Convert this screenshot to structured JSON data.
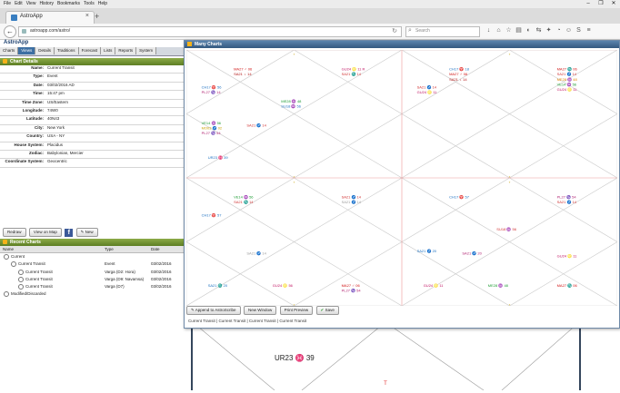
{
  "browser": {
    "menu": [
      "File",
      "Edit",
      "View",
      "History",
      "Bookmarks",
      "Tools",
      "Help"
    ],
    "tab_title": "AstroApp",
    "url": "astroapp.com/astro/",
    "search_placeholder": "Search",
    "window_controls": [
      "–",
      "❐",
      "✕"
    ]
  },
  "app": {
    "title": "AstroApp",
    "tabs": [
      "Charts",
      "Views",
      "Details",
      "Traditions",
      "Forecast",
      "Lists",
      "Reports",
      "System"
    ],
    "active_tab": "Views"
  },
  "chart_details": {
    "header": "Chart Details",
    "rows": [
      {
        "k": "Name:",
        "v": "Current Transit"
      },
      {
        "k": "Type:",
        "v": "Event"
      },
      {
        "k": "Date:",
        "v": "03/02/2016 AD"
      },
      {
        "k": "Time:",
        "v": "15:47 pm"
      },
      {
        "k": "Time Zone:",
        "v": "US/Eastern"
      },
      {
        "k": "Longitude:",
        "v": "74W0"
      },
      {
        "k": "Latitude:",
        "v": "40N43"
      },
      {
        "k": "City:",
        "v": "New York"
      },
      {
        "k": "Country:",
        "v": "USA - NY"
      },
      {
        "k": "House System:",
        "v": "Placidus"
      },
      {
        "k": "Zodiac:",
        "v": "Babylonian, Mercier"
      },
      {
        "k": "Coordinate System:",
        "v": "Geocentric"
      }
    ],
    "buttons": {
      "redraw": "Redraw",
      "view_on_map": "View on Map",
      "facebook": "f",
      "new": "New"
    }
  },
  "recent_charts": {
    "header": "Recent Charts",
    "columns": [
      "Name",
      "Type",
      "Date"
    ],
    "rows": [
      {
        "indent": 0,
        "name": "Current",
        "type": "",
        "date": ""
      },
      {
        "indent": 1,
        "name": "Current Transit",
        "type": "Event",
        "date": "03/02/2016"
      },
      {
        "indent": 2,
        "name": "Current Transit",
        "type": "Varga (D2: Hora)",
        "date": "03/02/2016"
      },
      {
        "indent": 2,
        "name": "Current Transit",
        "type": "Varga (D9: Navamsa)",
        "date": "03/02/2016"
      },
      {
        "indent": 2,
        "name": "Current Transit",
        "type": "Varga (D7)",
        "date": "03/02/2016"
      },
      {
        "indent": 0,
        "name": "Modified/Discarded",
        "type": "",
        "date": ""
      }
    ]
  },
  "many_charts": {
    "header": "Many Charts",
    "buttons": [
      "Append to AstroScribe",
      "New Window",
      "Print Preview",
      "Save"
    ],
    "footer_links": [
      "Current Transit",
      "Current Transit",
      "Current Transit",
      "Current Transit"
    ],
    "chart_labels": [
      {
        "cell": 0,
        "text": "MA27 ♂ 06",
        "color": "#d01010",
        "pos": "tl"
      },
      {
        "cell": 0,
        "text": "SA21 ♄ 14",
        "color": "#b01010",
        "pos": "tl2"
      },
      {
        "cell": 0,
        "text": "CH17 ♈ 56",
        "color": "#1a6fc0",
        "pos": "left"
      },
      {
        "cell": 0,
        "text": "PL27 ♑ 14",
        "color": "#b02070",
        "pos": "left2"
      },
      {
        "cell": 0,
        "text": "GU24 ♌ 11 R",
        "color": "#c01060",
        "pos": "right"
      },
      {
        "cell": 0,
        "text": "SA21 ♏ 14",
        "color": "#d03030",
        "pos": "right2"
      },
      {
        "cell": 0,
        "text": "ME28 ♒ 48",
        "color": "#1a9a30",
        "pos": "center"
      },
      {
        "cell": 0,
        "text": "SU18 ♒ 56",
        "color": "#1a6fc0",
        "pos": "center2"
      },
      {
        "cell": 0,
        "text": "SA21 ♐ 14",
        "color": "#d03030",
        "pos": "lower"
      },
      {
        "cell": 0,
        "text": "VE14 ♒ 56",
        "color": "#1a9a30",
        "pos": "lowerleft"
      },
      {
        "cell": 0,
        "text": "MO03 ♐ 02",
        "color": "#c8a000",
        "pos": "lowerleft2"
      },
      {
        "cell": 0,
        "text": "PL27 ♑ 54",
        "color": "#b02070",
        "pos": "lowerleft3"
      },
      {
        "cell": 0,
        "text": "UR23 ♓ 39",
        "color": "#1a6fc0",
        "pos": "bottom"
      },
      {
        "cell": 1,
        "text": "CH17 ♈ 18",
        "color": "#1a6fc0",
        "pos": "tl"
      },
      {
        "cell": 1,
        "text": "MA27 ♂ 06",
        "color": "#d01010",
        "pos": "tl2"
      },
      {
        "cell": 1,
        "text": "SA21 ♄ 14",
        "color": "#b01010",
        "pos": "tl3"
      },
      {
        "cell": 1,
        "text": "SA21 ♐ 14",
        "color": "#d03030",
        "pos": "left"
      },
      {
        "cell": 1,
        "text": "GU24 ♌ 11",
        "color": "#c01060",
        "pos": "left2"
      },
      {
        "cell": 1,
        "text": "MA27 ♏ 06",
        "color": "#d01010",
        "pos": "right"
      },
      {
        "cell": 1,
        "text": "SA21 ♐ 14",
        "color": "#d03030",
        "pos": "right2"
      },
      {
        "cell": 1,
        "text": "ME28 ♒ 48",
        "color": "#e08000",
        "pos": "right3"
      },
      {
        "cell": 1,
        "text": "VE14 ♒ 56",
        "color": "#1a9a30",
        "pos": "right4"
      },
      {
        "cell": 1,
        "text": "GU24 ♌ 11",
        "color": "#c01060",
        "pos": "right5"
      },
      {
        "cell": 2,
        "text": "CH17 ♈ 57",
        "color": "#1a6fc0",
        "pos": "left"
      },
      {
        "cell": 2,
        "text": "VE14 ♒ 56",
        "color": "#1a9a30",
        "pos": "tl"
      },
      {
        "cell": 2,
        "text": "SA21 ♏ 14",
        "color": "#d03030",
        "pos": "tl2"
      },
      {
        "cell": 2,
        "text": "SA21 ♐ 14",
        "color": "#d03030",
        "pos": "right"
      },
      {
        "cell": 2,
        "text": "SA21 ♐ 14",
        "color": "#999999",
        "pos": "lower"
      },
      {
        "cell": 2,
        "text": "SA21 ♐ 14",
        "color": "#999999",
        "pos": "right2"
      },
      {
        "cell": 2,
        "text": "SA21 ♏ 20",
        "color": "#1a6fc0",
        "pos": "bottom"
      },
      {
        "cell": 2,
        "text": "GU24 ♌ 56",
        "color": "#c01060",
        "pos": "bottom2"
      },
      {
        "cell": 2,
        "text": "MA27 ♂ 06",
        "color": "#d01010",
        "pos": "bottom3"
      },
      {
        "cell": 2,
        "text": "PL27 ♑ 54",
        "color": "#b02070",
        "pos": "bottom4"
      },
      {
        "cell": 3,
        "text": "CH17 ♈ 57",
        "color": "#1a6fc0",
        "pos": "tl"
      },
      {
        "cell": 3,
        "text": "PL27 ♑ 54",
        "color": "#b02070",
        "pos": "right"
      },
      {
        "cell": 3,
        "text": "SA21 ♐ 14",
        "color": "#d03030",
        "pos": "right2"
      },
      {
        "cell": 3,
        "text": "SU18 ♒ 56",
        "color": "#d03030",
        "pos": "center"
      },
      {
        "cell": 3,
        "text": "SA21 ♐ 20",
        "color": "#b02070",
        "pos": "lower"
      },
      {
        "cell": 3,
        "text": "GU24 ♌ 11",
        "color": "#c01060",
        "pos": "bottom"
      },
      {
        "cell": 3,
        "text": "ME28 ♒ 48",
        "color": "#1a9a30",
        "pos": "bottom2"
      },
      {
        "cell": 3,
        "text": "MA27 ♏ 06",
        "color": "#d01010",
        "pos": "bottom3"
      },
      {
        "cell": 3,
        "text": "SA21 ♐ 20",
        "color": "#1a6fc0",
        "pos": "lowerleft"
      },
      {
        "cell": 3,
        "text": "GU24 ♌ 11",
        "color": "#c01060",
        "pos": "lowerright"
      }
    ]
  },
  "background_chart": {
    "label": "UR23 ♓ 39",
    "color": "#1a4fa0"
  },
  "colors": {
    "accent": "#3d6fa3",
    "panel_green": "#6f8f30",
    "dialog_header": "#46698f",
    "grid_line": "#c8c8c8",
    "red_line": "#e88"
  }
}
